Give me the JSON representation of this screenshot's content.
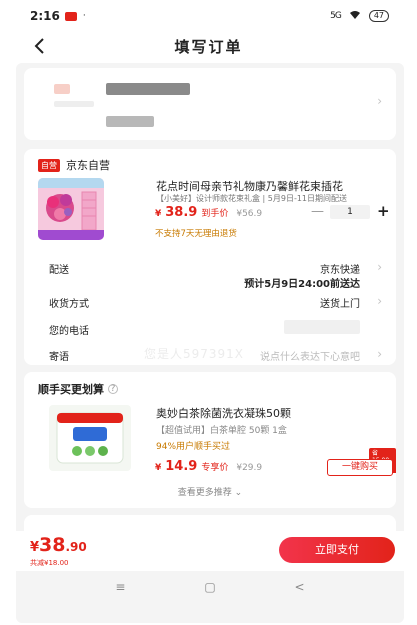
{
  "status_bar": {
    "time": "2:16",
    "dot": "·",
    "signal": "5G",
    "battery": "47"
  },
  "header": {
    "title": "填写订单"
  },
  "store": {
    "badge": "自营",
    "name": "京东自营",
    "product": {
      "title": "花点时间母亲节礼物康乃馨鲜花束插花",
      "subtitle": "【小美好】设计师款花束礼盒 | 5月9日-11日期间配送",
      "price_yen": "¥",
      "price": "38.9",
      "price_tag": "到手价",
      "original_price": "¥56.9",
      "quantity": "1",
      "qty_minus": "—",
      "qty_plus": "+",
      "return_policy": "不支持7天无理由退货"
    },
    "rows": {
      "delivery_label": "配送",
      "delivery_value": "京东快递",
      "delivery_eta": "预计5月9日24:00前送达",
      "receive_label": "收货方式",
      "receive_value": "送货上门",
      "phone_label": "您的电话",
      "message_label": "寄语",
      "message_placeholder": "说点什么表达下心意吧"
    },
    "watermark": "您是人597391X"
  },
  "recommend": {
    "title": "顺手买更划算",
    "info": "?",
    "product_title": "奥妙白茶除菌洗衣凝珠50颗",
    "product_sub": "【超值试用】白茶单腔 50颗 1盒",
    "buyers": "94%用户顺手买过",
    "price_yen": "¥",
    "price": "14.9",
    "price_tag": "专享价",
    "original_price": "¥29.9",
    "save_badge": "省15.00元",
    "buy_button": "一键购买",
    "more": "查看更多推荐 ⌄"
  },
  "footer": {
    "total_yen": "¥",
    "total_int": "38",
    "total_dec": ".90",
    "saved": "共减¥18.00",
    "pay_button": "立即支付"
  },
  "system_nav": {
    "menu": "≡",
    "home": "▢",
    "back": "<"
  }
}
